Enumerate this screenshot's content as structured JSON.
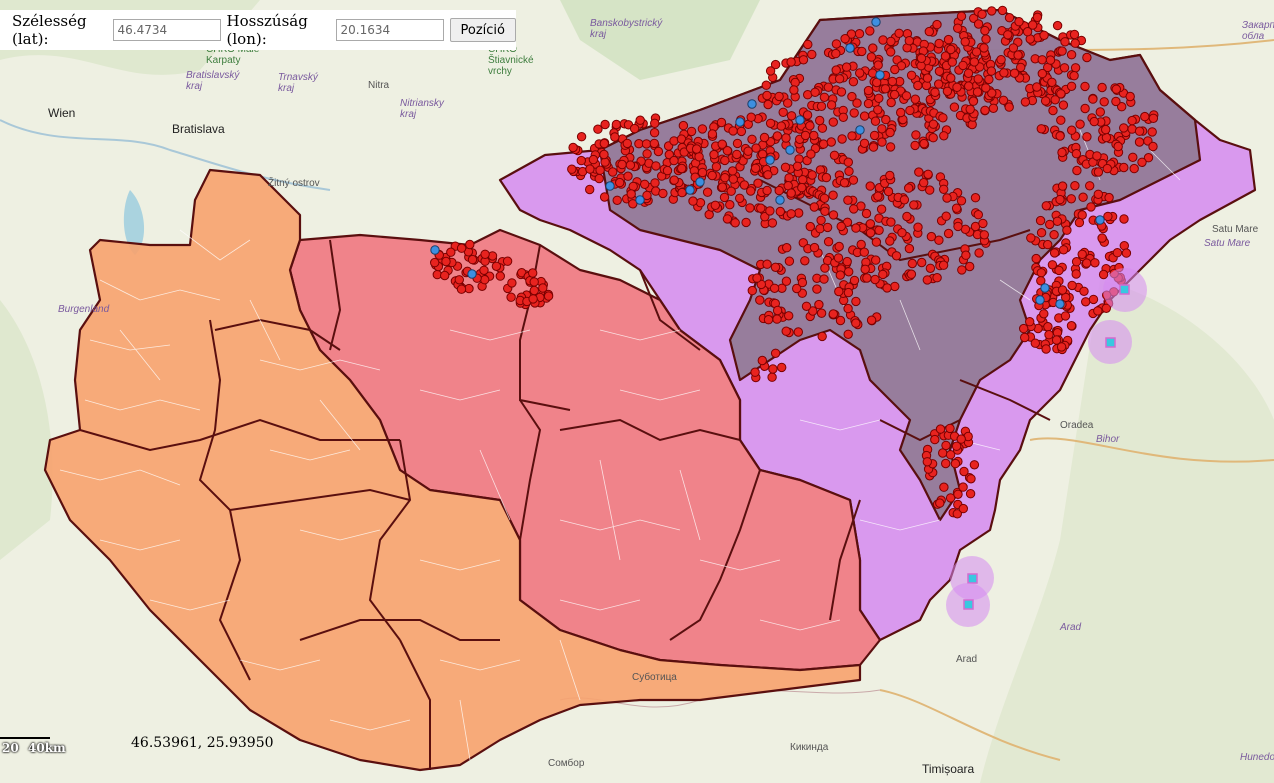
{
  "toolbar": {
    "lat_label": "Szélesség (lat):",
    "lat_value": "46.4734",
    "lon_label": "Hosszúság (lon):",
    "lon_value": "20.1634",
    "button_label": "Pozíció"
  },
  "places": {
    "wien": "Wien",
    "bratislava": "Bratislava",
    "nitra": "Nitra",
    "zitny_ostrov": "Žitný ostrov",
    "chko_male_karpaty": "CHKO Malé Karpaty",
    "bratislavsky_kraj": "Bratislavský kraj",
    "trnavsky_kraj": "Trnavský kraj",
    "nitriansky_kraj": "Nitriansky kraj",
    "banskobystricky_kraj": "Banskobystrický kraj",
    "chko_stiavnicke": "CHKO Štiavnické vrchy",
    "zakarpattia": "Закарп обла",
    "satu_mare_city": "Satu Mare",
    "satu_mare_region": "Satu Mare",
    "burgenland": "Burgenland",
    "oradea": "Oradea",
    "bihor": "Bihor",
    "arad_city": "Arad",
    "arad_region": "Arad",
    "subotica": "Суботица",
    "sombor": "Сомбор",
    "kikinda": "Кикинда",
    "timisoara": "Timișoara",
    "hunedoara": "Hunedo"
  },
  "scale": {
    "label_a": "20",
    "label_b": "40km"
  },
  "cursor_coords": "46.53961, 25.93950",
  "colors": {
    "base_map": "#f2efe9",
    "west_region": "#f7a26e",
    "central_region": "#f0707a",
    "east_region": "#d58af0",
    "north_region": "#8f7a92",
    "county_border": "#5a0f0f",
    "red_marker": "#e8231f",
    "blue_marker": "#3d8fe0",
    "cyan_marker": "#38c8e0"
  }
}
